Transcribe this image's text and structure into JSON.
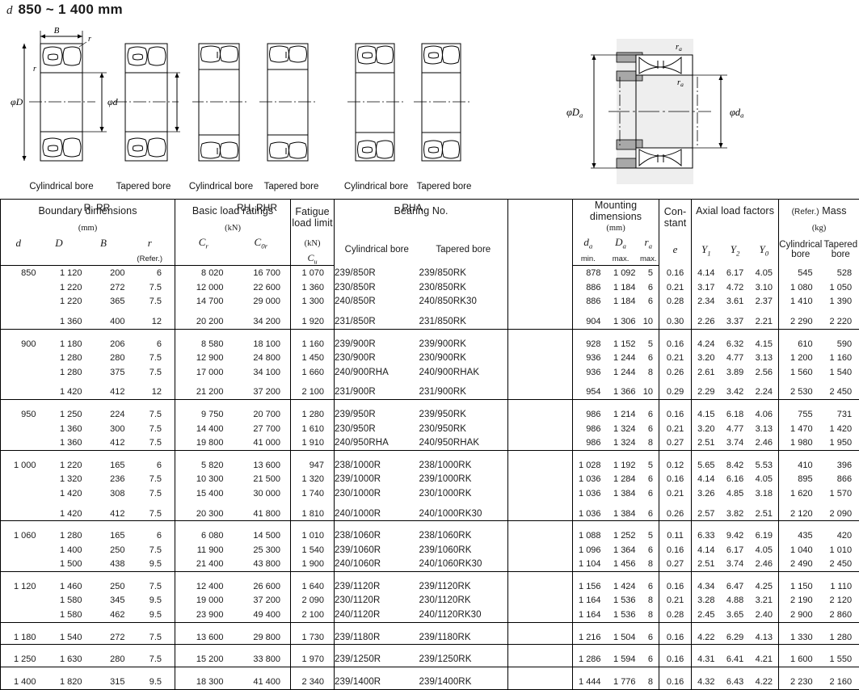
{
  "page": {
    "symbol": "d",
    "title": "850 ~ 1 400 mm"
  },
  "figures": {
    "labels": {
      "B": "B",
      "r": "r",
      "phiD": "φD",
      "phid": "φd",
      "phiDa": "φD",
      "phida": "φd",
      "ra": "r"
    },
    "groups": [
      {
        "name": "group-r-rr",
        "caption_left": "Cylindrical bore",
        "caption_right": "Tapered bore",
        "series": "R, RR"
      },
      {
        "name": "group-rh-rhr",
        "caption_left": "Cylindrical bore",
        "caption_right": "Tapered bore",
        "series": "RH, RHR"
      },
      {
        "name": "group-rha",
        "caption_left": "Cylindrical bore",
        "caption_right": "Tapered bore",
        "series": "RHA"
      }
    ]
  },
  "table": {
    "headers": {
      "boundary_dimensions": "Boundary dimensions",
      "boundary_unit": "(mm)",
      "d": "d",
      "D": "D",
      "B": "B",
      "r": "r",
      "r_refer": "(Refer.)",
      "basic_load_ratings": "Basic load ratings",
      "basic_unit": "(kN)",
      "Cr": "C",
      "Cr_sub": "r",
      "C0r": "C",
      "C0r_sub": "0r",
      "fatigue_line1": "Fatigue",
      "fatigue_line2": "load limit",
      "fatigue_unit": "(kN)",
      "Cu": "C",
      "Cu_sub": "u",
      "bearing_no": "Bearing No.",
      "cylindrical_bore": "Cylindrical bore",
      "tapered_bore": "Tapered bore",
      "mounting_dimensions": "Mounting dimensions",
      "mounting_unit": "(mm)",
      "da": "d",
      "da_sub": "a",
      "da_minmax": "min.",
      "Da": "D",
      "Da_sub": "a",
      "Da_minmax": "max.",
      "ra": "r",
      "ra_sub": "a",
      "ra_minmax": "max.",
      "constant_line1": "Con-",
      "constant_line2": "stant",
      "e": "e",
      "axial_load_factors": "Axial load factors",
      "Y1": "Y",
      "Y1_sub": "1",
      "Y2": "Y",
      "Y2_sub": "2",
      "Y0": "Y",
      "Y0_sub": "0",
      "mass_refer": "(Refer.)",
      "mass": "Mass",
      "mass_unit": "(kg)",
      "mass_cyl_line1": "Cylindrical",
      "mass_cyl_line2": "bore",
      "mass_tap_line1": "Tapered",
      "mass_tap_line2": "bore"
    },
    "groups": [
      {
        "d": "850",
        "rows": [
          {
            "gap_before": false,
            "D": "1 120",
            "B": "200",
            "r": "6",
            "Cr": "8 020",
            "C0r": "16 700",
            "Cu": "1 070",
            "cyl": "239/850R",
            "tap": "239/850RK",
            "da": "878",
            "Da": "1 092",
            "ra": "5",
            "e": "0.16",
            "Y1": "4.14",
            "Y2": "6.17",
            "Y0": "4.05",
            "m_cyl": "545",
            "m_tap": "528"
          },
          {
            "gap_before": false,
            "D": "1 220",
            "B": "272",
            "r": "7.5",
            "Cr": "12 000",
            "C0r": "22 600",
            "Cu": "1 360",
            "cyl": "230/850R",
            "tap": "230/850RK",
            "da": "886",
            "Da": "1 184",
            "ra": "6",
            "e": "0.21",
            "Y1": "3.17",
            "Y2": "4.72",
            "Y0": "3.10",
            "m_cyl": "1 080",
            "m_tap": "1 050"
          },
          {
            "gap_before": false,
            "D": "1 220",
            "B": "365",
            "r": "7.5",
            "Cr": "14 700",
            "C0r": "29 000",
            "Cu": "1 300",
            "cyl": "240/850R",
            "tap": "240/850RK30",
            "da": "886",
            "Da": "1 184",
            "ra": "6",
            "e": "0.28",
            "Y1": "2.34",
            "Y2": "3.61",
            "Y0": "2.37",
            "m_cyl": "1 410",
            "m_tap": "1 390"
          },
          {
            "gap_before": true,
            "D": "1 360",
            "B": "400",
            "r": "12",
            "Cr": "20 200",
            "C0r": "34 200",
            "Cu": "1 920",
            "cyl": "231/850R",
            "tap": "231/850RK",
            "da": "904",
            "Da": "1 306",
            "ra": "10",
            "e": "0.30",
            "Y1": "2.26",
            "Y2": "3.37",
            "Y0": "2.21",
            "m_cyl": "2 290",
            "m_tap": "2 220"
          }
        ]
      },
      {
        "d": "900",
        "rows": [
          {
            "gap_before": false,
            "D": "1 180",
            "B": "206",
            "r": "6",
            "Cr": "8 580",
            "C0r": "18 100",
            "Cu": "1 160",
            "cyl": "239/900R",
            "tap": "239/900RK",
            "da": "928",
            "Da": "1 152",
            "ra": "5",
            "e": "0.16",
            "Y1": "4.24",
            "Y2": "6.32",
            "Y0": "4.15",
            "m_cyl": "610",
            "m_tap": "590"
          },
          {
            "gap_before": false,
            "D": "1 280",
            "B": "280",
            "r": "7.5",
            "Cr": "12 900",
            "C0r": "24 800",
            "Cu": "1 450",
            "cyl": "230/900R",
            "tap": "230/900RK",
            "da": "936",
            "Da": "1 244",
            "ra": "6",
            "e": "0.21",
            "Y1": "3.20",
            "Y2": "4.77",
            "Y0": "3.13",
            "m_cyl": "1 200",
            "m_tap": "1 160"
          },
          {
            "gap_before": false,
            "D": "1 280",
            "B": "375",
            "r": "7.5",
            "Cr": "17 000",
            "C0r": "34 100",
            "Cu": "1 660",
            "cyl": "240/900RHA",
            "tap": "240/900RHAK",
            "da": "936",
            "Da": "1 244",
            "ra": "8",
            "e": "0.26",
            "Y1": "2.61",
            "Y2": "3.89",
            "Y0": "2.56",
            "m_cyl": "1 560",
            "m_tap": "1 540"
          },
          {
            "gap_before": true,
            "D": "1 420",
            "B": "412",
            "r": "12",
            "Cr": "21 200",
            "C0r": "37 200",
            "Cu": "2 100",
            "cyl": "231/900R",
            "tap": "231/900RK",
            "da": "954",
            "Da": "1 366",
            "ra": "10",
            "e": "0.29",
            "Y1": "2.29",
            "Y2": "3.42",
            "Y0": "2.24",
            "m_cyl": "2 530",
            "m_tap": "2 450"
          }
        ]
      },
      {
        "d": "950",
        "rows": [
          {
            "gap_before": false,
            "D": "1 250",
            "B": "224",
            "r": "7.5",
            "Cr": "9 750",
            "C0r": "20 700",
            "Cu": "1 280",
            "cyl": "239/950R",
            "tap": "239/950RK",
            "da": "986",
            "Da": "1 214",
            "ra": "6",
            "e": "0.16",
            "Y1": "4.15",
            "Y2": "6.18",
            "Y0": "4.06",
            "m_cyl": "755",
            "m_tap": "731"
          },
          {
            "gap_before": false,
            "D": "1 360",
            "B": "300",
            "r": "7.5",
            "Cr": "14 400",
            "C0r": "27 700",
            "Cu": "1 610",
            "cyl": "230/950R",
            "tap": "230/950RK",
            "da": "986",
            "Da": "1 324",
            "ra": "6",
            "e": "0.21",
            "Y1": "3.20",
            "Y2": "4.77",
            "Y0": "3.13",
            "m_cyl": "1 470",
            "m_tap": "1 420"
          },
          {
            "gap_before": false,
            "D": "1 360",
            "B": "412",
            "r": "7.5",
            "Cr": "19 800",
            "C0r": "41 000",
            "Cu": "1 910",
            "cyl": "240/950RHA",
            "tap": "240/950RHAK",
            "da": "986",
            "Da": "1 324",
            "ra": "8",
            "e": "0.27",
            "Y1": "2.51",
            "Y2": "3.74",
            "Y0": "2.46",
            "m_cyl": "1 980",
            "m_tap": "1 950"
          }
        ]
      },
      {
        "d": "1 000",
        "rows": [
          {
            "gap_before": false,
            "D": "1 220",
            "B": "165",
            "r": "6",
            "Cr": "5 820",
            "C0r": "13 600",
            "Cu": "947",
            "cyl": "238/1000R",
            "tap": "238/1000RK",
            "da": "1 028",
            "Da": "1 192",
            "ra": "5",
            "e": "0.12",
            "Y1": "5.65",
            "Y2": "8.42",
            "Y0": "5.53",
            "m_cyl": "410",
            "m_tap": "396"
          },
          {
            "gap_before": false,
            "D": "1 320",
            "B": "236",
            "r": "7.5",
            "Cr": "10 300",
            "C0r": "21 500",
            "Cu": "1 320",
            "cyl": "239/1000R",
            "tap": "239/1000RK",
            "da": "1 036",
            "Da": "1 284",
            "ra": "6",
            "e": "0.16",
            "Y1": "4.14",
            "Y2": "6.16",
            "Y0": "4.05",
            "m_cyl": "895",
            "m_tap": "866"
          },
          {
            "gap_before": false,
            "D": "1 420",
            "B": "308",
            "r": "7.5",
            "Cr": "15 400",
            "C0r": "30 000",
            "Cu": "1 740",
            "cyl": "230/1000R",
            "tap": "230/1000RK",
            "da": "1 036",
            "Da": "1 384",
            "ra": "6",
            "e": "0.21",
            "Y1": "3.26",
            "Y2": "4.85",
            "Y0": "3.18",
            "m_cyl": "1 620",
            "m_tap": "1 570"
          },
          {
            "gap_before": true,
            "D": "1 420",
            "B": "412",
            "r": "7.5",
            "Cr": "20 300",
            "C0r": "41 800",
            "Cu": "1 810",
            "cyl": "240/1000R",
            "tap": "240/1000RK30",
            "da": "1 036",
            "Da": "1 384",
            "ra": "6",
            "e": "0.26",
            "Y1": "2.57",
            "Y2": "3.82",
            "Y0": "2.51",
            "m_cyl": "2 120",
            "m_tap": "2 090"
          }
        ]
      },
      {
        "d": "1 060",
        "rows": [
          {
            "gap_before": false,
            "D": "1 280",
            "B": "165",
            "r": "6",
            "Cr": "6 080",
            "C0r": "14 500",
            "Cu": "1 010",
            "cyl": "238/1060R",
            "tap": "238/1060RK",
            "da": "1 088",
            "Da": "1 252",
            "ra": "5",
            "e": "0.11",
            "Y1": "6.33",
            "Y2": "9.42",
            "Y0": "6.19",
            "m_cyl": "435",
            "m_tap": "420"
          },
          {
            "gap_before": false,
            "D": "1 400",
            "B": "250",
            "r": "7.5",
            "Cr": "11 900",
            "C0r": "25 300",
            "Cu": "1 540",
            "cyl": "239/1060R",
            "tap": "239/1060RK",
            "da": "1 096",
            "Da": "1 364",
            "ra": "6",
            "e": "0.16",
            "Y1": "4.14",
            "Y2": "6.17",
            "Y0": "4.05",
            "m_cyl": "1 040",
            "m_tap": "1 010"
          },
          {
            "gap_before": false,
            "D": "1 500",
            "B": "438",
            "r": "9.5",
            "Cr": "21 400",
            "C0r": "43 800",
            "Cu": "1 900",
            "cyl": "240/1060R",
            "tap": "240/1060RK30",
            "da": "1 104",
            "Da": "1 456",
            "ra": "8",
            "e": "0.27",
            "Y1": "2.51",
            "Y2": "3.74",
            "Y0": "2.46",
            "m_cyl": "2 490",
            "m_tap": "2 450"
          }
        ]
      },
      {
        "d": "1 120",
        "rows": [
          {
            "gap_before": false,
            "D": "1 460",
            "B": "250",
            "r": "7.5",
            "Cr": "12 400",
            "C0r": "26 600",
            "Cu": "1 640",
            "cyl": "239/1120R",
            "tap": "239/1120RK",
            "da": "1 156",
            "Da": "1 424",
            "ra": "6",
            "e": "0.16",
            "Y1": "4.34",
            "Y2": "6.47",
            "Y0": "4.25",
            "m_cyl": "1 150",
            "m_tap": "1 110"
          },
          {
            "gap_before": false,
            "D": "1 580",
            "B": "345",
            "r": "9.5",
            "Cr": "19 000",
            "C0r": "37 200",
            "Cu": "2 090",
            "cyl": "230/1120R",
            "tap": "230/1120RK",
            "da": "1 164",
            "Da": "1 536",
            "ra": "8",
            "e": "0.21",
            "Y1": "3.28",
            "Y2": "4.88",
            "Y0": "3.21",
            "m_cyl": "2 190",
            "m_tap": "2 120"
          },
          {
            "gap_before": false,
            "D": "1 580",
            "B": "462",
            "r": "9.5",
            "Cr": "23 900",
            "C0r": "49 400",
            "Cu": "2 100",
            "cyl": "240/1120R",
            "tap": "240/1120RK30",
            "da": "1 164",
            "Da": "1 536",
            "ra": "8",
            "e": "0.28",
            "Y1": "2.45",
            "Y2": "3.65",
            "Y0": "2.40",
            "m_cyl": "2 900",
            "m_tap": "2 860"
          }
        ]
      },
      {
        "d": "1 180",
        "rows": [
          {
            "gap_before": false,
            "D": "1 540",
            "B": "272",
            "r": "7.5",
            "Cr": "13 600",
            "C0r": "29 800",
            "Cu": "1 730",
            "cyl": "239/1180R",
            "tap": "239/1180RK",
            "da": "1 216",
            "Da": "1 504",
            "ra": "6",
            "e": "0.16",
            "Y1": "4.22",
            "Y2": "6.29",
            "Y0": "4.13",
            "m_cyl": "1 330",
            "m_tap": "1 280"
          }
        ]
      },
      {
        "d": "1 250",
        "rows": [
          {
            "gap_before": false,
            "D": "1 630",
            "B": "280",
            "r": "7.5",
            "Cr": "15 200",
            "C0r": "33 800",
            "Cu": "1 970",
            "cyl": "239/1250R",
            "tap": "239/1250RK",
            "da": "1 286",
            "Da": "1 594",
            "ra": "6",
            "e": "0.16",
            "Y1": "4.31",
            "Y2": "6.41",
            "Y0": "4.21",
            "m_cyl": "1 600",
            "m_tap": "1 550"
          }
        ]
      },
      {
        "d": "1 400",
        "rows": [
          {
            "gap_before": false,
            "D": "1 820",
            "B": "315",
            "r": "9.5",
            "Cr": "18 300",
            "C0r": "41 400",
            "Cu": "2 340",
            "cyl": "239/1400R",
            "tap": "239/1400RK",
            "da": "1 444",
            "Da": "1 776",
            "ra": "8",
            "e": "0.16",
            "Y1": "4.32",
            "Y2": "6.43",
            "Y0": "4.22",
            "m_cyl": "2 230",
            "m_tap": "2 160"
          }
        ]
      }
    ]
  },
  "colors": {
    "ink": "#1a1a1a",
    "rule": "#000000",
    "shaft_fill": "#b3b3b3",
    "housing_fill": "#ebebeb"
  }
}
